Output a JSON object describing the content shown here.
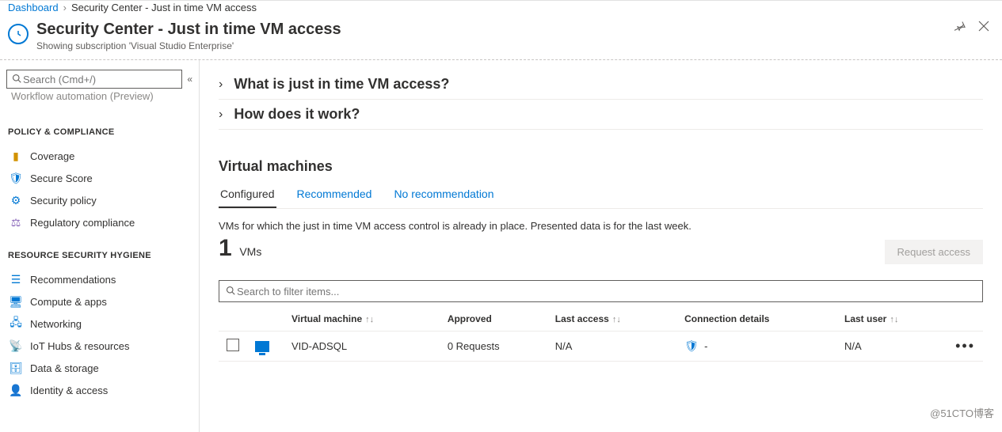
{
  "breadcrumb": {
    "root": "Dashboard",
    "current": "Security Center - Just in time VM access"
  },
  "header": {
    "title": "Security Center - Just in time VM access",
    "subtitle": "Showing subscription 'Visual Studio Enterprise'"
  },
  "search": {
    "placeholder": "Search (Cmd+/)"
  },
  "sidebar": {
    "cut_item": "Workflow automation (Preview)",
    "section1": "POLICY & COMPLIANCE",
    "items1": [
      {
        "label": "Coverage"
      },
      {
        "label": "Secure Score"
      },
      {
        "label": "Security policy"
      },
      {
        "label": "Regulatory compliance"
      }
    ],
    "section2": "RESOURCE SECURITY HYGIENE",
    "items2": [
      {
        "label": "Recommendations"
      },
      {
        "label": "Compute & apps"
      },
      {
        "label": "Networking"
      },
      {
        "label": "IoT Hubs & resources"
      },
      {
        "label": "Data & storage"
      },
      {
        "label": "Identity & access"
      }
    ]
  },
  "main": {
    "expander1": "What is just in time VM access?",
    "expander2": "How does it work?",
    "vm_title": "Virtual machines",
    "tabs": {
      "configured": "Configured",
      "recommended": "Recommended",
      "norec": "No recommendation"
    },
    "desc": "VMs for which the just in time VM access control is already in place. Presented data is for the last week.",
    "count_number": "1",
    "count_label": "VMs",
    "request_access_btn": "Request access",
    "filter_placeholder": "Search to filter items...",
    "columns": {
      "vm": "Virtual machine",
      "approved": "Approved",
      "last_access": "Last access",
      "conn": "Connection details",
      "last_user": "Last user"
    },
    "rows": [
      {
        "vm": "VID-ADSQL",
        "approved": "0 Requests",
        "last_access": "N/A",
        "conn": "-",
        "last_user": "N/A"
      }
    ]
  },
  "watermark": "@51CTO博客"
}
